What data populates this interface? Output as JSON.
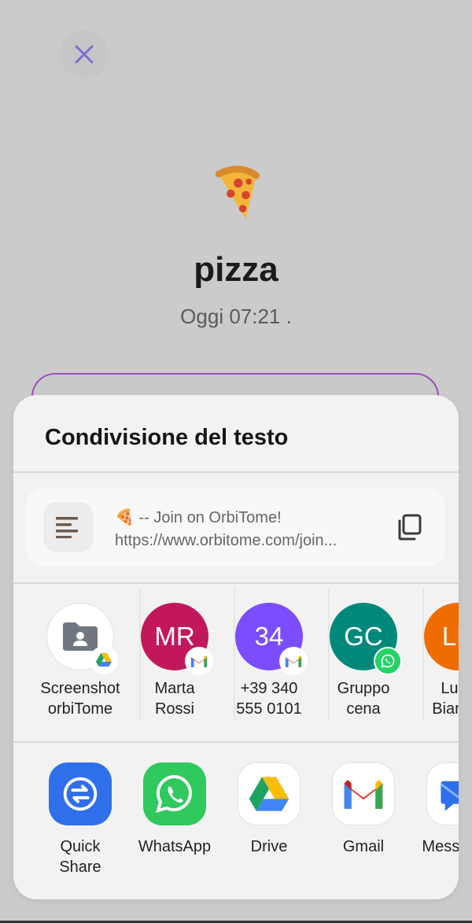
{
  "background": {
    "close_icon": "close-icon",
    "event_emoji": "🍕",
    "event_title": "pizza",
    "event_date": "Oggi 07:21 ."
  },
  "sheet": {
    "title": "Condivisione del testo",
    "preview": {
      "line1": "🍕 -- Join on OrbiTome!",
      "line2": "https://www.orbitome.com/join..."
    },
    "contacts": [
      {
        "label1": "Screenshot",
        "label2": "orbiTome",
        "initials": "",
        "color": "#ffffff",
        "badge": "drive"
      },
      {
        "label1": "Marta",
        "label2": "Rossi",
        "initials": "MR",
        "color": "#c2185b",
        "badge": "gmail"
      },
      {
        "label1": "+39 340",
        "label2": "555 0101",
        "initials": "34",
        "color": "#7c4dff",
        "badge": "gmail"
      },
      {
        "label1": "Gruppo",
        "label2": "cena",
        "initials": "GC",
        "color": "#00897b",
        "badge": "whatsapp"
      },
      {
        "label1": "Luca",
        "label2": "Bianchi",
        "initials": "LB",
        "color": "#ef6c00",
        "badge": "none"
      }
    ],
    "apps": [
      {
        "label1": "Quick",
        "label2": "Share"
      },
      {
        "label1": "WhatsApp",
        "label2": ""
      },
      {
        "label1": "Drive",
        "label2": ""
      },
      {
        "label1": "Gmail",
        "label2": ""
      },
      {
        "label1": "Messages",
        "label2": ""
      }
    ]
  }
}
